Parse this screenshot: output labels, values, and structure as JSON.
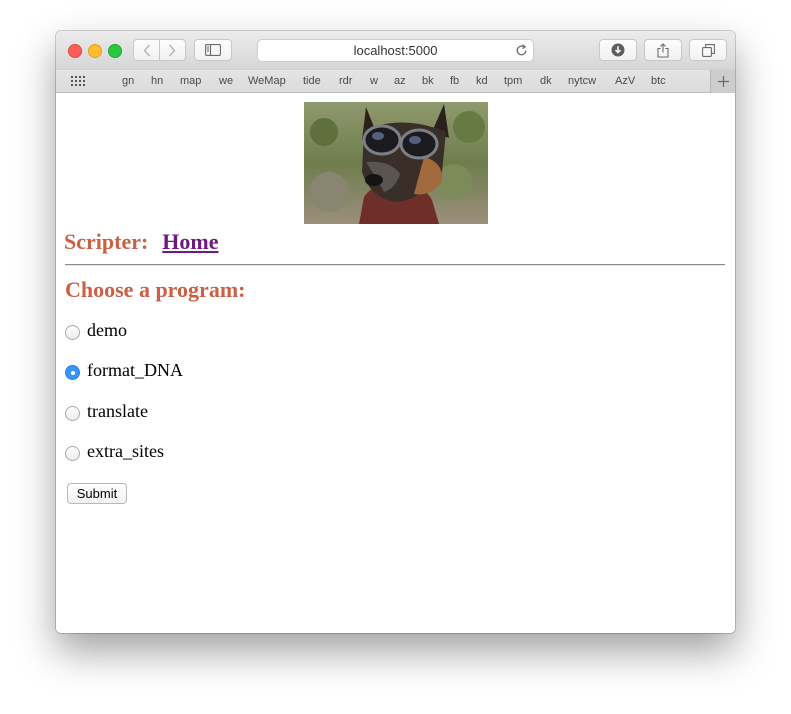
{
  "browser": {
    "url": "localhost:5000",
    "bookmarks": [
      "gn",
      "hn",
      "map",
      "we",
      "WeMap",
      "tide",
      "rdr",
      "w",
      "az",
      "bk",
      "fb",
      "kd",
      "tpm",
      "dk",
      "nytcw",
      "AzV",
      "btc"
    ]
  },
  "page": {
    "heading_label": "Scripter:",
    "home_link": "Home",
    "choose_heading": "Choose a program:",
    "options": [
      {
        "label": "demo",
        "checked": false
      },
      {
        "label": "format_DNA",
        "checked": true
      },
      {
        "label": "translate",
        "checked": false
      },
      {
        "label": "extra_sites",
        "checked": false
      }
    ],
    "submit_label": "Submit"
  },
  "colors": {
    "heading": "#cb6045",
    "link_visited": "#6e1b80",
    "radio_checked": "#3b93f7"
  },
  "icons": [
    "back-icon",
    "forward-icon",
    "sidebar-icon",
    "reload-icon",
    "download-icon",
    "share-icon",
    "tabs-icon",
    "grid-icon",
    "plus-icon"
  ]
}
